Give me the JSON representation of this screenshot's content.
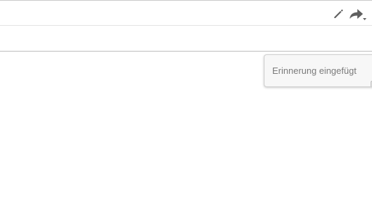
{
  "toolbar": {
    "edit_icon": "pencil-icon",
    "forward_icon": "forward-arrow-icon",
    "forward_dropdown_icon": "caret-down-icon"
  },
  "notification": {
    "message": "Erinnerung eingefügt"
  },
  "colors": {
    "icon": "#5f5f5f",
    "toast_text": "#7a7a7a",
    "toast_background": "#f7f7f7"
  }
}
